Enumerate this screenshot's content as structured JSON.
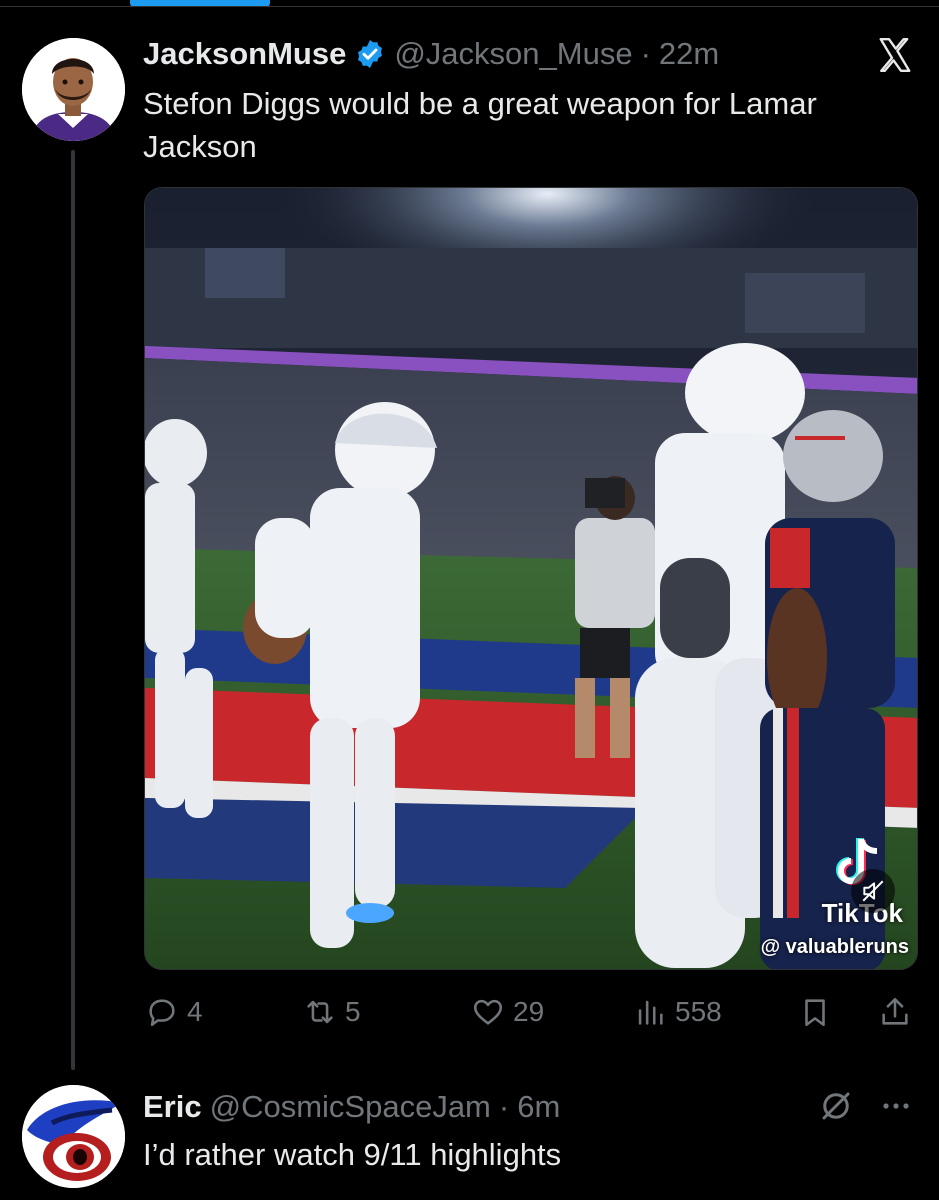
{
  "tweet": {
    "author_name": "JacksonMuse",
    "author_handle": "@Jackson_Muse",
    "separator": "·",
    "time": "22m",
    "text": "Stefon Diggs would be a great weapon for Lamar Jackson",
    "media": {
      "watermark_brand": "TikTok",
      "watermark_user": "@ valuableruns"
    },
    "actions": {
      "replies": "4",
      "reposts": "5",
      "likes": "29",
      "views": "558"
    }
  },
  "reply": {
    "author_name": "Eric",
    "author_handle": "@CosmicSpaceJam",
    "separator": "·",
    "time": "6m",
    "text": "I’d rather watch 9/11 highlights"
  },
  "colors": {
    "background": "#000000",
    "text": "#e7e9ea",
    "secondary_text": "#71767b",
    "accent": "#1d9bf0",
    "divider": "#2f3336"
  },
  "icons": {
    "verified": "verified-badge-icon",
    "platform": "x-logo-icon",
    "reply": "reply-bubble-icon",
    "repost": "repost-icon",
    "like": "heart-icon",
    "views": "views-bar-icon",
    "bookmark": "bookmark-icon",
    "share": "share-icon",
    "grok": "grok-icon",
    "more": "more-dots-icon",
    "mute": "muted-speaker-icon"
  }
}
